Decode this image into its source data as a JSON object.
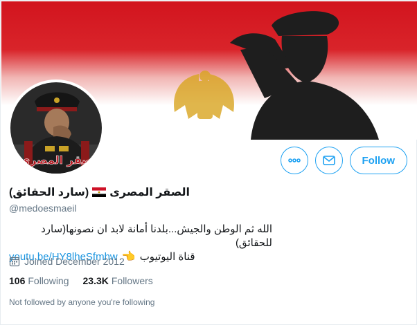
{
  "profile": {
    "name": "الصقر المصرى",
    "name_suffix": "(سارد الحقائق)",
    "handle": "@medoesmaeil",
    "bio_line1": "الله ثم الوطن والجيش...بلدنا أمانة لابد ان نصونها(سارد للحقائق)",
    "bio_link": "youtu.be/HY8lheSfmhw",
    "bio_line2": "قناة اليوتيوب",
    "joined": "Joined December 2012",
    "avatar_caption": "صقر المصري"
  },
  "actions": {
    "more_icon": "more-icon",
    "message_icon": "mail-icon",
    "follow_label": "Follow"
  },
  "stats": {
    "following_count": "106",
    "following_label": "Following",
    "followers_count": "23.3K",
    "followers_label": "Followers"
  },
  "followed_note": "Not followed by anyone you're following",
  "colors": {
    "accent": "#1da1f2",
    "link": "#1b95e0",
    "muted": "#657786",
    "flag_red": "#ce1126",
    "flag_black": "#000000",
    "eagle_gold": "#c09300"
  }
}
